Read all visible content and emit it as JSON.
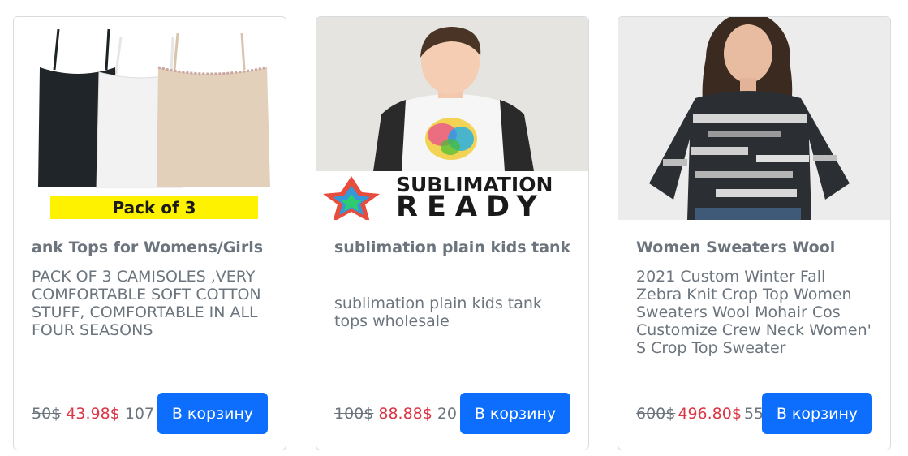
{
  "products": [
    {
      "title": "ank Tops for Womens/Girls",
      "description": "PACK OF 3 CAMISOLES ,VERY COMFORTABLE SOFT COTTON STUFF, COMFORTABLE IN ALL FOUR SEASONS",
      "old_price": "50$",
      "new_price": "43.98$",
      "quantity": "107",
      "button_label": "В корзину",
      "image_banner": "Pack of 3"
    },
    {
      "title": "sublimation plain kids tank",
      "description": "sublimation plain kids tank tops wholesale",
      "old_price": "100$",
      "new_price": "88.88$",
      "quantity": "20",
      "button_label": "В корзину",
      "image_banner": "SUBLIMATION",
      "image_banner_2": "READY"
    },
    {
      "title": "Women Sweaters Wool",
      "description": "2021 Custom Winter Fall Zebra Knit Crop Top Women Sweaters Wool Mohair Cos Customize Crew Neck Women' S Crop Top Sweater",
      "old_price": "600$",
      "new_price": "496.80$",
      "quantity": "55",
      "button_label": "В корзину"
    }
  ],
  "colors": {
    "button": "#0d6efd",
    "sale_price": "#dc3545",
    "muted_text": "#6c757d"
  }
}
